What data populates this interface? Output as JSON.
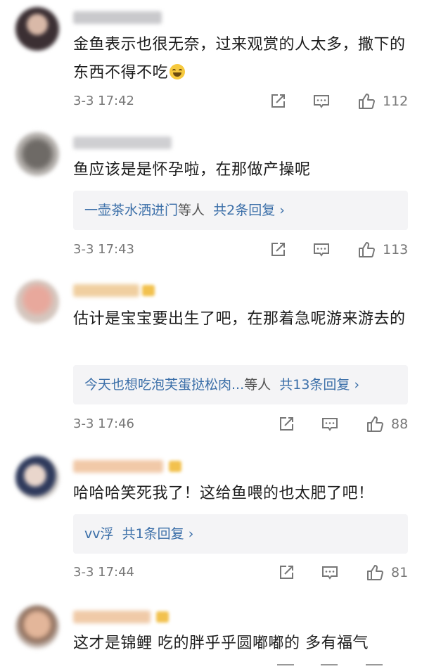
{
  "comments": [
    {
      "text": "金鱼表示也很无奈，过来观赏的人太多，撒下的东西不得不吃",
      "emoji": "laughing-tears-emoji",
      "time": "3-3 17:42",
      "likes": "112",
      "reply": null
    },
    {
      "text": "鱼应该是是怀孕啦，在那做产操呢",
      "time": "3-3 17:43",
      "likes": "113",
      "reply": {
        "users": "一壶茶水洒进门",
        "suffix": "等人",
        "count_text": "共2条回复 ›"
      }
    },
    {
      "text": "估计是宝宝要出生了吧，在那着急呢游来游去的",
      "time": "3-3 17:46",
      "likes": "88",
      "reply": {
        "users": "今天也想吃泡芙蛋挞松肉...",
        "suffix": "等人",
        "count_text": "共13条回复 ›"
      }
    },
    {
      "text": "哈哈哈笑死我了！这给鱼喂的也太肥了吧！",
      "time": "3-3 17:44",
      "likes": "81",
      "reply": {
        "users": "vv浮",
        "suffix": "",
        "count_text": "共1条回复 ›"
      }
    },
    {
      "text": "这才是锦鲤 吃的胖乎乎圆嘟嘟的 多有福气"
    }
  ],
  "icons": {
    "share": "share-icon",
    "comment": "comment-icon",
    "like": "thumbs-up-icon"
  },
  "colors": {
    "link": "#3a6ea8",
    "meta": "#777777",
    "reply_bg": "#f4f4f6"
  }
}
